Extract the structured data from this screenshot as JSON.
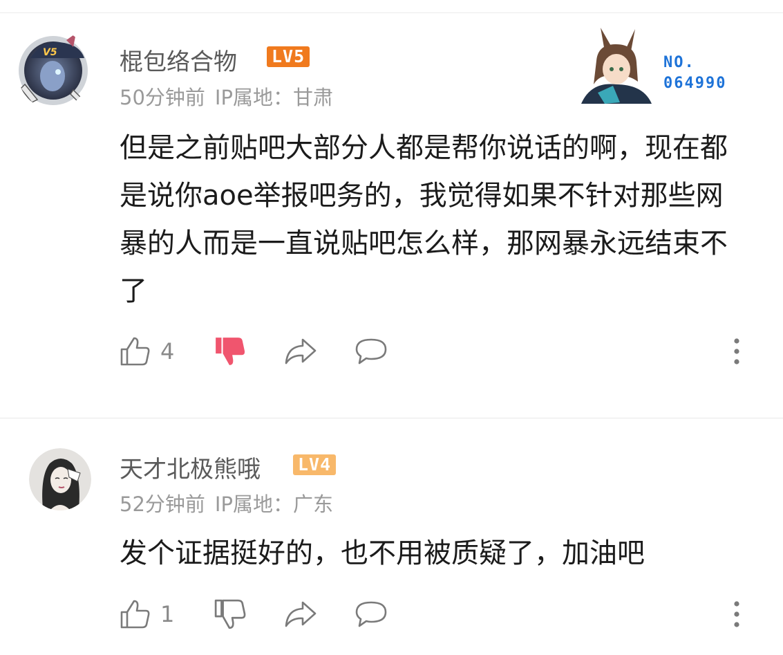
{
  "comments": [
    {
      "username": "棍包络合物",
      "level": "LV5",
      "level_color": "#f07a1e",
      "time": "50分钟前",
      "ip_label": "IP属地：甘肃",
      "text": "但是之前贴吧大部分人都是帮你说话的啊，现在都是说你aoe举报吧务的，我觉得如果不针对那些网暴的人而是一直说贴吧怎么样，那网暴永远结束不了",
      "pendant_line1": "NO.",
      "pendant_line2": "064990",
      "like_count": "4",
      "dislike_active": true,
      "dislike_color": "#f0556e",
      "icons": {
        "avatar": "hooded-character-avatar",
        "pendant": "bunny-ear-anime-character-pendant",
        "like": "thumbs-up-icon",
        "dislike": "thumbs-down-filled-icon",
        "share": "share-arrow-icon",
        "reply": "speech-bubble-icon",
        "more": "more-vertical-icon"
      }
    },
    {
      "username": "天才北极熊哦",
      "level": "LV4",
      "level_color": "#f8b86a",
      "time": "52分钟前",
      "ip_label": "IP属地：广东",
      "text": "发个证据挺好的，也不用被质疑了，加油吧",
      "like_count": "1",
      "dislike_active": false,
      "icons": {
        "avatar": "sketch-girl-avatar",
        "like": "thumbs-up-icon",
        "dislike": "thumbs-down-icon",
        "share": "share-arrow-icon",
        "reply": "speech-bubble-icon",
        "more": "more-vertical-icon"
      }
    }
  ],
  "colors": {
    "icon_gray": "#7a7a7a",
    "username_gray": "#5a5a5a",
    "meta_gray": "#9a9a9a",
    "pendant_blue": "#1e73d8"
  }
}
